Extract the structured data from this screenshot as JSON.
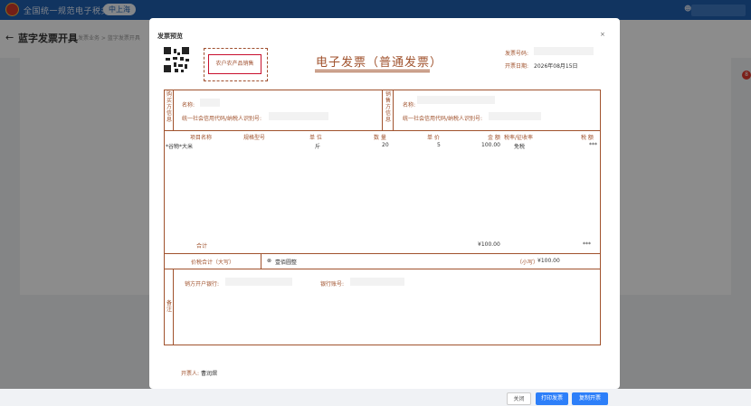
{
  "header": {
    "site_title": "全国统一规范电子税务局",
    "region_badge": "中上海"
  },
  "subheader": {
    "page_title": "蓝字发票开具",
    "breadcrumb": "发票业务 > 蓝字发票开具"
  },
  "notice": {
    "count": "8"
  },
  "modal": {
    "title": "发票预览",
    "close_label": "×",
    "stamp_text": "农户农产品销售",
    "invoice_title": "电子发票（普通发票）",
    "invoice_no_label": "发票号码:",
    "issue_date_label": "开票日期:",
    "issue_date_value": "2026年08月15日",
    "buyer": {
      "side_label": "购买方信息",
      "name_label": "名称:",
      "tax_id_label": "统一社会信用代码/纳税人识别号:"
    },
    "seller": {
      "side_label": "销售方信息",
      "name_label": "名称:",
      "tax_id_label": "统一社会信用代码/纳税人识别号:"
    },
    "columns": {
      "item_name": "项目名称",
      "spec": "规格型号",
      "unit": "单 位",
      "quantity": "数 量",
      "price": "单 价",
      "amount": "金 额",
      "tax_rate": "税率/征收率",
      "tax": "税 额"
    },
    "rows": [
      {
        "item_name": "*谷物*大米",
        "unit": "斤",
        "quantity": "20",
        "price": "5",
        "amount": "100.00",
        "tax_rate": "免税",
        "tax": "***"
      }
    ],
    "total": {
      "label": "合计",
      "amount": "¥100.00",
      "tax": "***"
    },
    "grand_total": {
      "label": "价税合计（大写）",
      "capital_value": "壹佰圆整",
      "small_label": "（小写）",
      "small_value": "¥100.00"
    },
    "remarks": {
      "side_label": "备注",
      "bank_label": "销方开户银行:",
      "account_label": "银行账号:"
    },
    "issuer_label": "开票人:",
    "issuer_name": "曹润熠",
    "buttons": {
      "close": "关闭",
      "print": "打印发票",
      "copy": "复制开票"
    }
  }
}
